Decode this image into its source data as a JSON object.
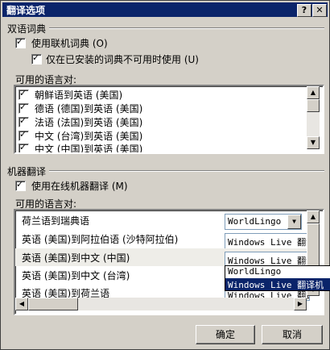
{
  "window": {
    "title": "翻译选项",
    "help_btn": "?",
    "close_btn": "✕"
  },
  "bilingual": {
    "heading": "双语词典",
    "use_online": "使用联机词典 (O)",
    "only_when_missing": "仅在已安装的词典不可用时使用 (U)",
    "pairs_heading": "可用的语言对:",
    "pairs": [
      "朝鲜语到英语 (美国)",
      "德语 (德国)到英语 (美国)",
      "法语 (法国)到英语 (美国)",
      "中文 (台湾)到英语 (美国)",
      "中文 (中国)到英语 (美国)"
    ]
  },
  "machine": {
    "heading": "机器翻译",
    "use_online": "使用在线机器翻译 (M)",
    "pairs_heading": "可用的语言对:",
    "rows": [
      {
        "label": "荷兰语到瑞典语",
        "service": "WorldLingo"
      },
      {
        "label": "英语 (美国)到阿拉伯语 (沙特阿拉伯)",
        "service": "Windows Live 翻译"
      },
      {
        "label": "英语 (美国)到中文 (中国)",
        "service": "Windows Live 翻译"
      },
      {
        "label": "英语 (美国)到中文 (台湾)",
        "service": ""
      },
      {
        "label": "英语 (美国)到荷兰语",
        "service": "Windows Live 翻译"
      }
    ],
    "dropdown_options": [
      "WorldLingo",
      "Windows Live 翻译机"
    ]
  },
  "buttons": {
    "ok": "确定",
    "cancel": "取消"
  }
}
